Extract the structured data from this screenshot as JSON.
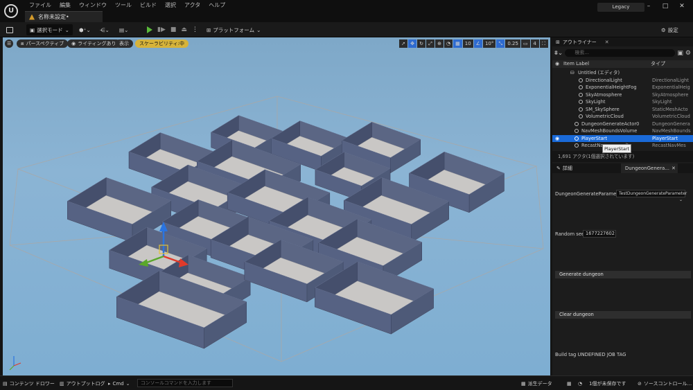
{
  "menu": [
    "ファイル",
    "編集",
    "ウィンドウ",
    "ツール",
    "ビルド",
    "選択",
    "アクタ",
    "ヘルプ"
  ],
  "document_tab": "名称未設定•",
  "legacy_label": "Legacy",
  "toolbar": {
    "select_mode": "選択モード",
    "platform": "プラットフォーム",
    "settings": "設定"
  },
  "viewport": {
    "perspective": "パースペクティブ",
    "lit": "ライティングあり",
    "show": "表示",
    "scalability": "スケーラビリティ:中",
    "grid_snap": "10",
    "rot_snap": "10°",
    "scale_snap": "0.25",
    "cam_speed": "4"
  },
  "outliner": {
    "tab": "アウトライナー",
    "search_placeholder": "検索...",
    "col_label": "Item Label",
    "col_type": "タイプ",
    "rows": [
      {
        "name": "Untitled (エディタ)",
        "type": ""
      },
      {
        "name": "DirectionalLight",
        "type": "DirectionalLight"
      },
      {
        "name": "ExponentialHeightFog",
        "type": "ExponentialHeig"
      },
      {
        "name": "SkyAtmosphere",
        "type": "SkyAtmosphere"
      },
      {
        "name": "SkyLight",
        "type": "SkyLight"
      },
      {
        "name": "SM_SkySphere",
        "type": "StaticMeshActo"
      },
      {
        "name": "VolumetricCloud",
        "type": "VolumetricCloud"
      },
      {
        "name": "DungeonGenerateActor0",
        "type": "DungeonGenera"
      },
      {
        "name": "NavMeshBoundsVolume",
        "type": "NavMeshBounds"
      },
      {
        "name": "PlayerStart",
        "type": "PlayerStart"
      },
      {
        "name": "RecastNa",
        "name_tail": "lt",
        "type": "RecastNavMes"
      }
    ],
    "tooltip": "PlayerStart",
    "footer": "1,691 アクタ(1個選択されています)"
  },
  "details": {
    "tab_details": "詳細",
    "tab_dungeon": "DungeonGenera...",
    "param_label": "DungeonGenerateParameter",
    "param_value": "TestDungeonGenerateParameter",
    "seed_label": "Random seed",
    "seed_value": "1677227602",
    "generate_btn": "Generate dungeon",
    "clear_btn": "Clear dungeon",
    "build_tag_label": "Build tag",
    "build_tag_value": "UNDEFINED JOB TAG"
  },
  "statusbar": {
    "content_drawer": "コンテンツ ドロワー",
    "output_log": "アウトプットログ",
    "cmd": "Cmd",
    "console_placeholder": "コンソールコマンドを入力します",
    "derived_data": "派生データ",
    "unsaved": "1個が未保存です",
    "source_control": "ソースコントロール..."
  },
  "colors": {
    "selection": "#1a6ad8",
    "scalability_badge": "#d6b33a",
    "play": "#5aba3a",
    "sky": "#82aed0",
    "wall": "#4e5a78",
    "floor": "#c9c7c5"
  }
}
